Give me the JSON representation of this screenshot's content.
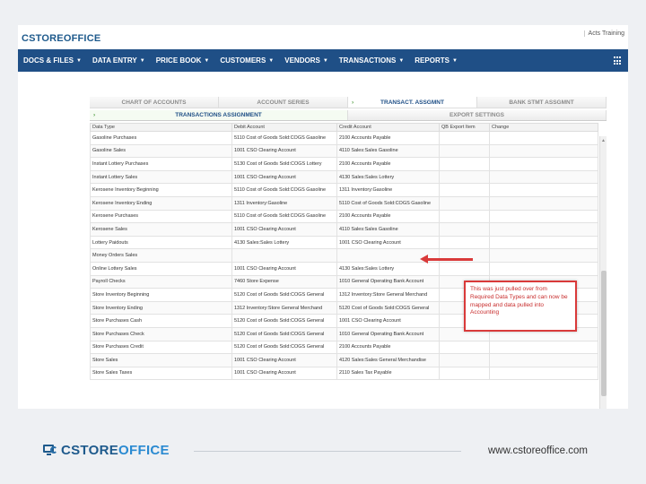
{
  "app": {
    "logo_text": "CSTOREOFFICE",
    "user_info": "Acts   Training"
  },
  "nav": {
    "items": [
      {
        "label": "DOCS & FILES"
      },
      {
        "label": "DATA ENTRY"
      },
      {
        "label": "PRICE BOOK"
      },
      {
        "label": "CUSTOMERS"
      },
      {
        "label": "VENDORS"
      },
      {
        "label": "TRANSACTIONS"
      },
      {
        "label": "REPORTS"
      }
    ]
  },
  "tabs_row1": [
    {
      "label": "CHART OF ACCOUNTS"
    },
    {
      "label": "ACCOUNT SERIES"
    },
    {
      "label": "TRANSACT. ASSGMNT"
    },
    {
      "label": "BANK STMT ASSGMNT"
    }
  ],
  "tabs_row2": [
    {
      "label": "TRANSACTIONS ASSIGNMENT"
    },
    {
      "label": "EXPORT SETTINGS"
    }
  ],
  "table": {
    "headers": [
      "Data Type",
      "Debit Account",
      "Credit Account",
      "QB Export Item",
      "Change"
    ],
    "rows": [
      [
        "Gasoline Purchases",
        "5110 Cost of Goods Sold:COGS Gasoline",
        "2100 Accounts Payable",
        "",
        ""
      ],
      [
        "Gasoline Sales",
        "1001 CSO Clearing Account",
        "4110 Sales:Sales Gasoline",
        "",
        ""
      ],
      [
        "Instant Lottery Purchases",
        "5130 Cost of Goods Sold:COGS Lottery",
        "2100 Accounts Payable",
        "",
        ""
      ],
      [
        "Instant Lottery Sales",
        "1001 CSO Clearing Account",
        "4130 Sales:Sales Lottery",
        "",
        ""
      ],
      [
        "Kerosene Inventory Beginning",
        "5110 Cost of Goods Sold:COGS Gasoline",
        "1311 Inventory:Gasoline",
        "",
        ""
      ],
      [
        "Kerosene Inventory Ending",
        "1311 Inventory:Gasoline",
        "5110 Cost of Goods Sold:COGS Gasoline",
        "",
        ""
      ],
      [
        "Kerosene Purchases",
        "5110 Cost of Goods Sold:COGS Gasoline",
        "2100 Accounts Payable",
        "",
        ""
      ],
      [
        "Kerosene Sales",
        "1001 CSO Clearing Account",
        "4110 Sales:Sales Gasoline",
        "",
        ""
      ],
      [
        "Lottery Paidouts",
        "4130 Sales:Sales Lottery",
        "1001 CSO Clearing Account",
        "",
        ""
      ],
      [
        "Money Orders Sales",
        "",
        "",
        "",
        ""
      ],
      [
        "Online Lottery Sales",
        "1001 CSO Clearing Account",
        "4130 Sales:Sales Lottery",
        "",
        ""
      ],
      [
        "Payroll Checks",
        "7460 Store Expense",
        "1010 General Operating Bank Account",
        "",
        ""
      ],
      [
        "Store Inventory Beginning",
        "5120 Cost of Goods Sold:COGS General",
        "1312 Inventory:Store General Merchand",
        "",
        ""
      ],
      [
        "Store Inventory Ending",
        "1312 Inventory:Store General Merchand",
        "5120 Cost of Goods Sold:COGS General",
        "",
        ""
      ],
      [
        "Store Purchases Cash",
        "5120 Cost of Goods Sold:COGS General",
        "1001 CSO Clearing Account",
        "",
        ""
      ],
      [
        "Store Purchases Check",
        "5120 Cost of Goods Sold:COGS General",
        "1010 General Operating Bank Account",
        "",
        ""
      ],
      [
        "Store Purchases Credit",
        "5120 Cost of Goods Sold:COGS General",
        "2100 Accounts Payable",
        "",
        ""
      ],
      [
        "Store Sales",
        "1001 CSO Clearing Account",
        "4120 Sales:Sales General Merchandise",
        "",
        ""
      ],
      [
        "Store Sales Taxes",
        "1001 CSO Clearing Account",
        "2110 Sales Tax Payable",
        "",
        ""
      ]
    ]
  },
  "callout": {
    "text": "This was just pulled over from Required Data Types and can now be mapped and data pulled into Accounting"
  },
  "footer": {
    "brand_part1": "CSTORE",
    "brand_part2": "OFFICE",
    "url": "www.cstoreoffice.com"
  },
  "colors": {
    "nav_bg": "#1f4f86",
    "accent_red": "#d93a3a",
    "brand_blue": "#1e5a8c"
  }
}
